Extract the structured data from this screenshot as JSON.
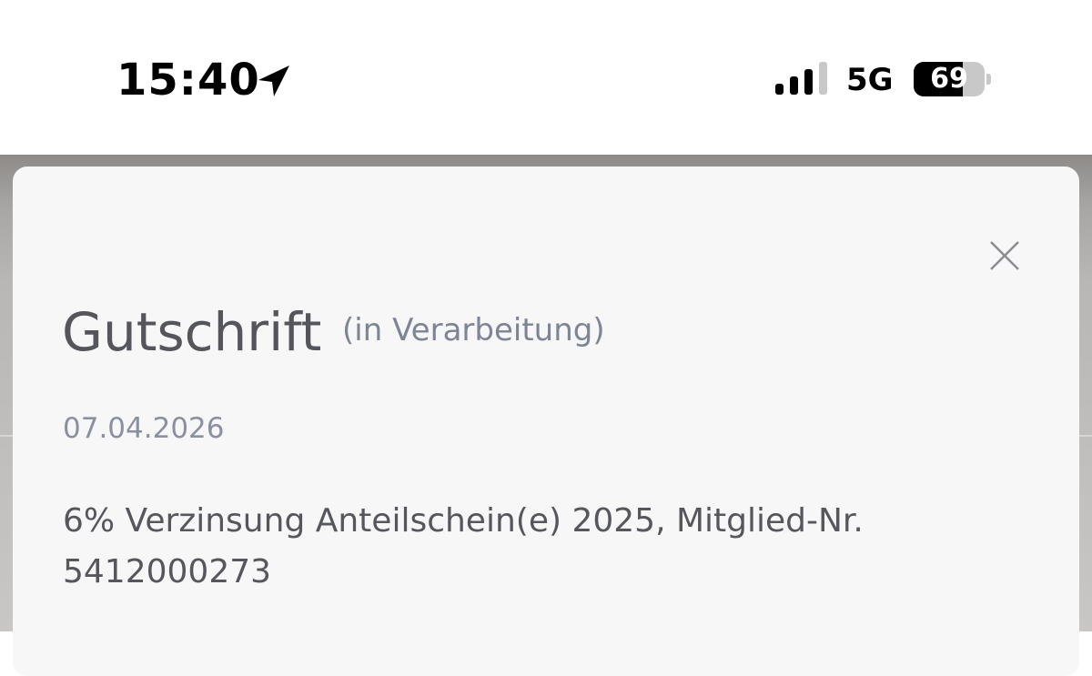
{
  "status_bar": {
    "time": "15:40",
    "network": "5G",
    "battery_level": "69",
    "battery_fraction": 0.69,
    "icons": [
      "location-arrow-icon",
      "cellular-signal-icon",
      "battery-icon"
    ]
  },
  "sheet": {
    "title": "Gutschrift",
    "status": "(in Verarbeitung)",
    "date": "07.04.2026",
    "description": "6% Verzinsung Anteilschein(e) 2025, Mitglied-Nr. 5412000273",
    "close_icon": "close-icon"
  },
  "colors": {
    "title": "#54565c",
    "muted": "#7c8496",
    "sheet_background": "#f7f7f7",
    "backdrop": "#a9a7a5"
  }
}
